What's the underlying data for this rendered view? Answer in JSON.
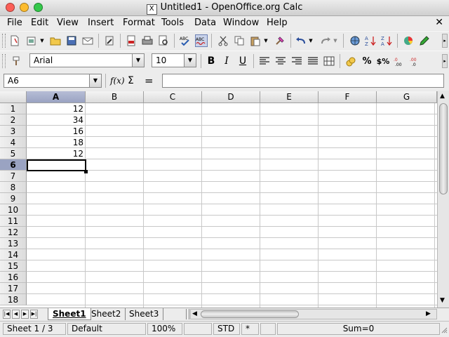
{
  "window": {
    "title": "Untitled1 - OpenOffice.org Calc",
    "x_icon": "X"
  },
  "menu": [
    "File",
    "Edit",
    "View",
    "Insert",
    "Format",
    "Tools",
    "Data",
    "Window",
    "Help"
  ],
  "menu_close": "✕",
  "format_toolbar": {
    "font_name": "Arial",
    "font_size": "10",
    "bold": "B",
    "italic": "I",
    "underline": "U"
  },
  "formula_bar": {
    "name_box": "A6",
    "function_wizard": "f(x)",
    "sum": "Σ",
    "equals": "=",
    "content": ""
  },
  "grid": {
    "columns": [
      "A",
      "B",
      "C",
      "D",
      "E",
      "F",
      "G"
    ],
    "selected_column": "A",
    "rows": [
      "1",
      "2",
      "3",
      "4",
      "5",
      "6",
      "7",
      "8",
      "9",
      "10",
      "11",
      "12",
      "13",
      "14",
      "15",
      "16",
      "17",
      "18"
    ],
    "selected_row": "6",
    "column_a_values": [
      "12",
      "34",
      "16",
      "18",
      "12"
    ]
  },
  "sheets": {
    "tabs": [
      "Sheet1",
      "Sheet2",
      "Sheet3"
    ],
    "active": "Sheet1"
  },
  "status_bar": {
    "sheet": "Sheet 1 / 3",
    "page_style": "Default",
    "zoom": "100%",
    "mode": "STD",
    "modified": "*",
    "sum": "Sum=0"
  },
  "colors": {
    "selected_header": "#9aa3c2",
    "grid_line": "#c8c8c8",
    "traffic_close": "#fc5f57",
    "traffic_min": "#fdbc2e",
    "traffic_max": "#34c84a"
  }
}
